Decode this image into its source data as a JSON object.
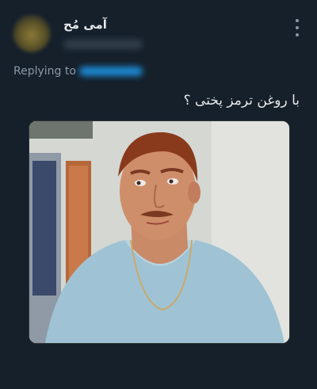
{
  "author": {
    "name": "آمی مُح"
  },
  "reply": {
    "prefix": "Replying to"
  },
  "tweet": {
    "text": "با روغن ترمز پختی ؟"
  },
  "media": {
    "description_icon": "photo-icon"
  },
  "colors": {
    "background": "#15202b",
    "text": "#e7e9ea",
    "secondary": "#8b98a5",
    "accent": "#1d9bf0"
  }
}
